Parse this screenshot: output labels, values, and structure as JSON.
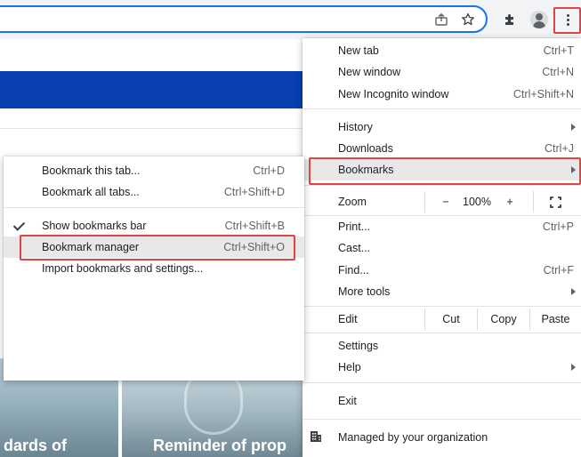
{
  "toolbar": {
    "share_icon": "share-icon",
    "star_icon": "bookmark-star-icon",
    "extensions_icon": "puzzle-icon",
    "profile_icon": "profile-avatar-icon",
    "menu_icon": "kebab-menu-icon"
  },
  "page": {
    "tile_left_text": "dards of",
    "tile_right_text": "Reminder of prop"
  },
  "main_menu": {
    "new_tab": {
      "label": "New tab",
      "shortcut": "Ctrl+T"
    },
    "new_window": {
      "label": "New window",
      "shortcut": "Ctrl+N"
    },
    "new_incognito": {
      "label": "New Incognito window",
      "shortcut": "Ctrl+Shift+N"
    },
    "history": {
      "label": "History"
    },
    "downloads": {
      "label": "Downloads",
      "shortcut": "Ctrl+J"
    },
    "bookmarks": {
      "label": "Bookmarks"
    },
    "zoom": {
      "label": "Zoom",
      "minus": "−",
      "value": "100%",
      "plus": "+"
    },
    "print": {
      "label": "Print...",
      "shortcut": "Ctrl+P"
    },
    "cast": {
      "label": "Cast..."
    },
    "find": {
      "label": "Find...",
      "shortcut": "Ctrl+F"
    },
    "more_tools": {
      "label": "More tools"
    },
    "edit": {
      "label": "Edit",
      "cut": "Cut",
      "copy": "Copy",
      "paste": "Paste"
    },
    "settings": {
      "label": "Settings"
    },
    "help": {
      "label": "Help"
    },
    "exit": {
      "label": "Exit"
    },
    "managed": {
      "label": "Managed by your organization"
    }
  },
  "bookmarks_submenu": {
    "bookmark_tab": {
      "label": "Bookmark this tab...",
      "shortcut": "Ctrl+D"
    },
    "bookmark_all": {
      "label": "Bookmark all tabs...",
      "shortcut": "Ctrl+Shift+D"
    },
    "show_bar": {
      "label": "Show bookmarks bar",
      "shortcut": "Ctrl+Shift+B",
      "checked": true
    },
    "manager": {
      "label": "Bookmark manager",
      "shortcut": "Ctrl+Shift+O"
    },
    "import": {
      "label": "Import bookmarks and settings..."
    }
  },
  "colors": {
    "highlight": "#e04545",
    "accent": "#1a73e8",
    "page_banner": "#0a3fb0"
  }
}
